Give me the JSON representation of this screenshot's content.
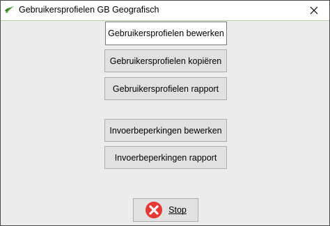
{
  "window": {
    "title": "Gebruikersprofielen GB Geografisch"
  },
  "buttons": {
    "edit_profiles": "Gebruikersprofielen bewerken",
    "copy_profiles": "Gebruikersprofielen kopiëren",
    "profiles_report": "Gebruikersprofielen rapport",
    "edit_restrictions": "Invoerbeperkingen bewerken",
    "restrictions_report": "Invoerbeperkingen rapport",
    "stop": "Stop"
  },
  "icons": {
    "app": "app-logo-icon",
    "close": "close-icon",
    "stop": "stop-x-icon"
  },
  "colors": {
    "stop_icon": "#e53935"
  }
}
